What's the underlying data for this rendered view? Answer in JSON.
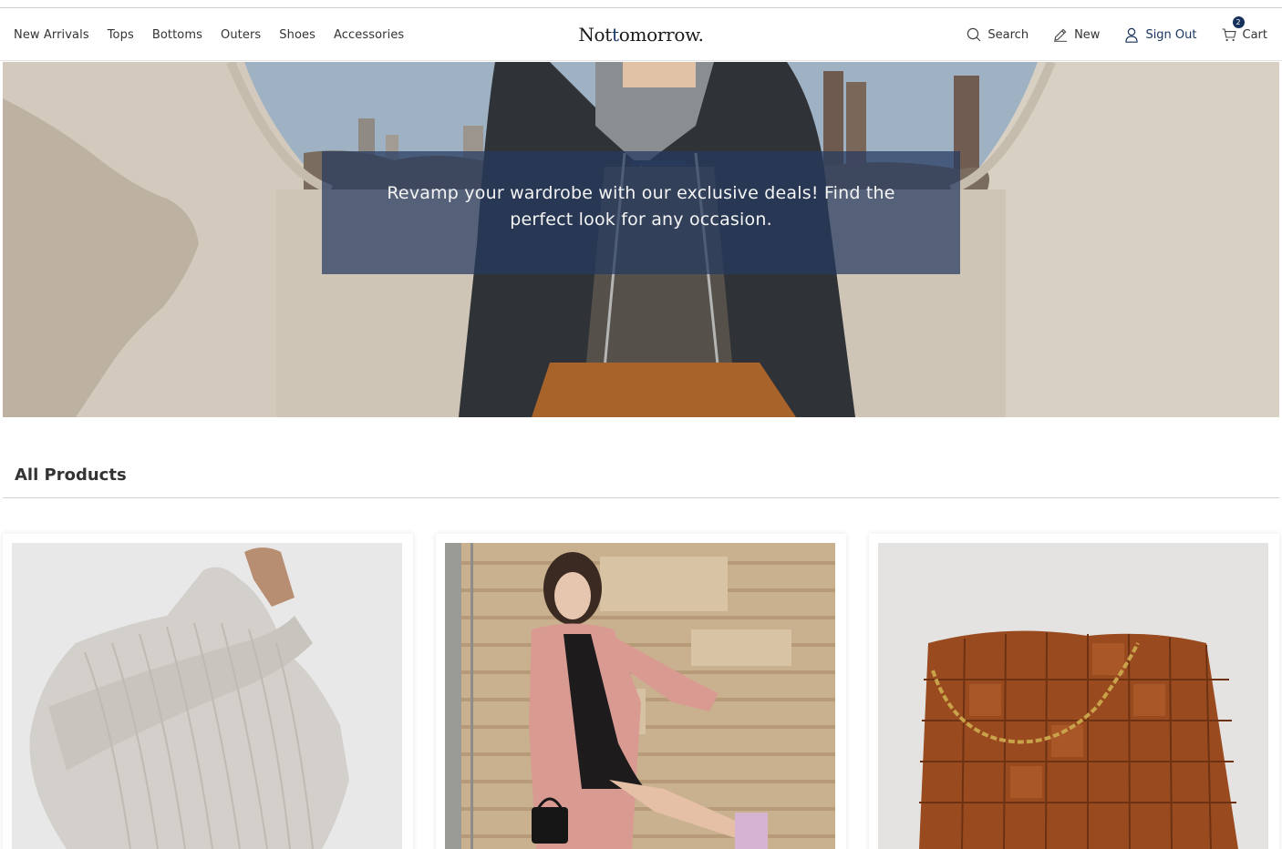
{
  "nav": {
    "categories": [
      "New Arrivals",
      "Tops",
      "Bottoms",
      "Outers",
      "Shoes",
      "Accessories"
    ],
    "logo": {
      "part1": "Not ",
      "accent": "t",
      "part2": "omorrow."
    },
    "search_label": "Search",
    "new_label": "New",
    "signout_label": "Sign Out",
    "cart_label": "Cart",
    "cart_count": "2"
  },
  "hero": {
    "text": "Revamp your wardrobe with our exclusive deals! Find the perfect look for any occasion."
  },
  "products": {
    "title": "All Products",
    "items": [
      {
        "image": "knit-sweater-photo"
      },
      {
        "image": "pink-coat-photo"
      },
      {
        "image": "woven-leather-bag-photo"
      }
    ]
  },
  "colors": {
    "accent": "#16325c",
    "overlay": "#263a60"
  }
}
